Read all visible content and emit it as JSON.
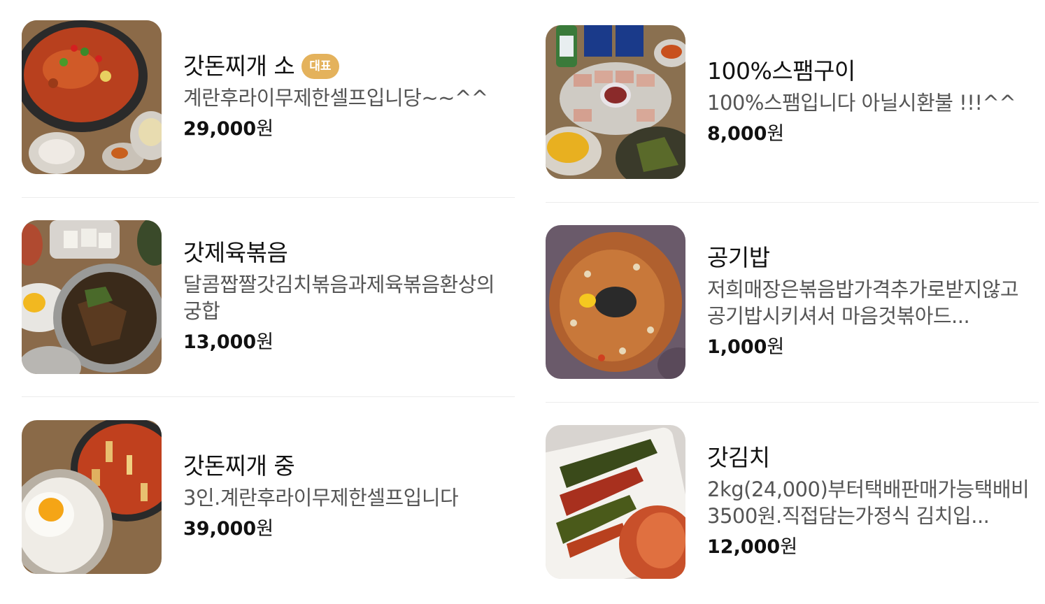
{
  "menu_items": [
    {
      "name": "갓돈찌개 소",
      "badge": "대표",
      "desc": "계란후라이무제한셀프입니당~~^^",
      "price": "29,000",
      "unit": "원",
      "image": "pork-kimchi-stew-photo"
    },
    {
      "name": "100%스팸구이",
      "badge": "",
      "desc": "100%스팸입니다 아닐시환불 !!!^^",
      "price": "8,000",
      "unit": "원",
      "image": "grilled-spam-photo"
    },
    {
      "name": "갓제육볶음",
      "badge": "",
      "desc": "달콤짭짤갓김치볶음과제육볶음환상의궁합",
      "price": "13,000",
      "unit": "원",
      "image": "stir-fried-pork-photo"
    },
    {
      "name": "공기밥",
      "badge": "",
      "desc": "저희매장은볶음밥가격추가로받지않고공기밥시키셔서 마음것볶아드...",
      "price": "1,000",
      "unit": "원",
      "image": "fried-rice-photo"
    },
    {
      "name": "갓돈찌개 중",
      "badge": "",
      "desc": "3인.계란후라이무제한셀프입니다",
      "price": "39,000",
      "unit": "원",
      "image": "stew-medium-photo"
    },
    {
      "name": "갓김치",
      "badge": "",
      "desc": "2kg(24,000)부터택배판매가능택배비3500원.직접담는가정식 김치입...",
      "price": "12,000",
      "unit": "원",
      "image": "mustard-kimchi-photo"
    }
  ],
  "colors": {
    "badge": "#e4b25c",
    "divider": "#ececec"
  }
}
